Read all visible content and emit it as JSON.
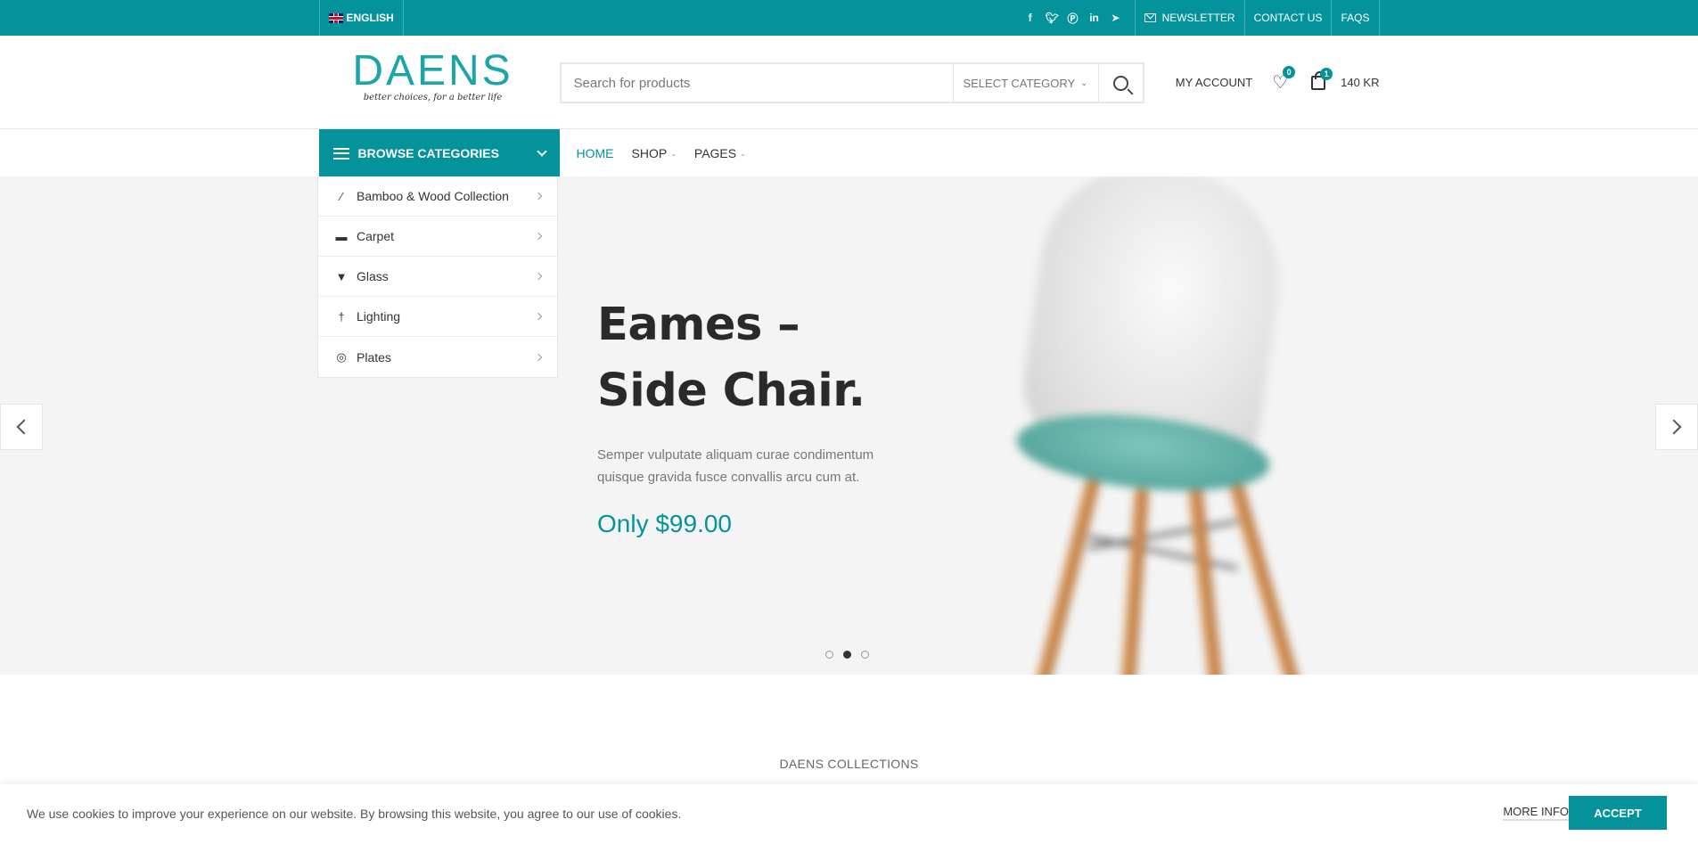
{
  "topbar": {
    "language": "ENGLISH",
    "social_icons": [
      "facebook-icon",
      "twitter-icon",
      "pinterest-icon",
      "linkedin-icon",
      "telegram-icon"
    ],
    "links": {
      "newsletter": "NEWSLETTER",
      "contact": "CONTACT US",
      "faqs": "FAQS"
    },
    "bg_color": "#05939b"
  },
  "header": {
    "logo_text": "DAENS",
    "logo_tagline": "better choices, for a better life",
    "search_placeholder": "Search for products",
    "category_select": "SELECT CATEGORY",
    "account": "MY ACCOUNT",
    "wishlist_count": "0",
    "cart_count": "1",
    "cart_total": "140 KR"
  },
  "nav": {
    "browse_label": "BROWSE CATEGORIES",
    "items": [
      {
        "label": "HOME",
        "active": true
      },
      {
        "label": "SHOP",
        "active": false
      },
      {
        "label": "PAGES",
        "active": false
      }
    ]
  },
  "categories": [
    {
      "label": "Bamboo & Wood Collection",
      "icon": "bamboo-icon"
    },
    {
      "label": "Carpet",
      "icon": "carpet-icon"
    },
    {
      "label": "Glass",
      "icon": "glass-icon"
    },
    {
      "label": "Lighting",
      "icon": "lamp-icon"
    },
    {
      "label": "Plates",
      "icon": "plate-icon"
    }
  ],
  "hero": {
    "title_line1": "Eames –",
    "title_line2": "Side Chair.",
    "description": "Semper vulputate aliquam curae condimentum quisque gravida fusce convallis arcu cum at.",
    "price": "Only $99.00",
    "active_slide": 2,
    "slide_count": 3
  },
  "section_title": "DAENS COLLECTIONS",
  "cookie": {
    "message": "We use cookies to improve your experience on our website. By browsing this website, you agree to our use of cookies.",
    "more_info": "MORE INFO",
    "accept": "ACCEPT"
  }
}
